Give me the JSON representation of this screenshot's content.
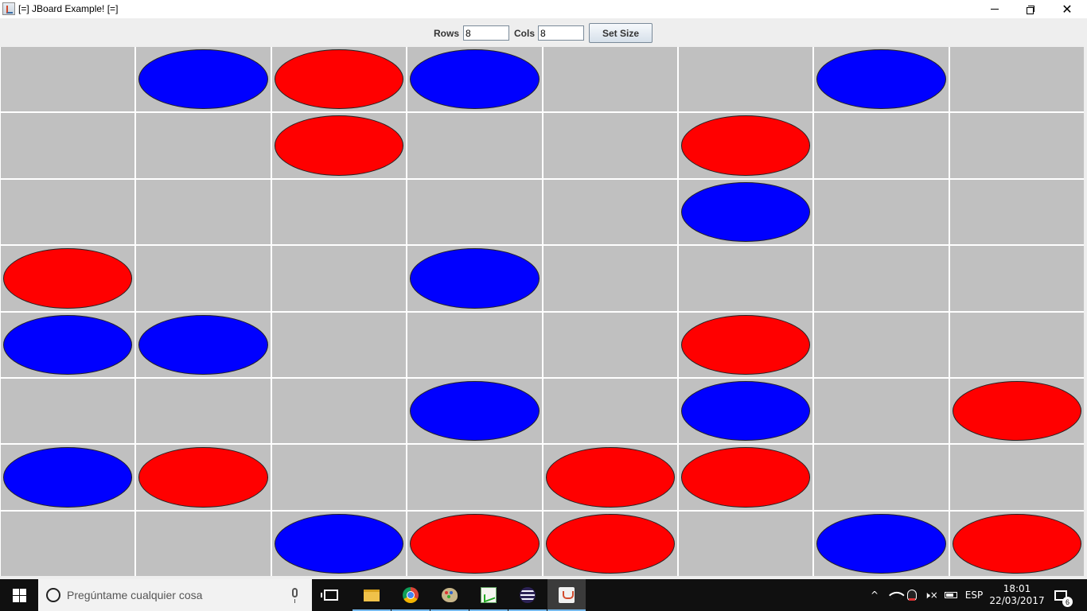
{
  "window": {
    "title": "[=] JBoard Example! [=]",
    "controls": {
      "minimize": "minimize",
      "maximize": "restore",
      "close": "close"
    }
  },
  "toolbar": {
    "rows_label": "Rows",
    "rows_value": "8",
    "cols_label": "Cols",
    "cols_value": "8",
    "set_size_label": "Set Size"
  },
  "board": {
    "rows": 8,
    "cols": 8,
    "empty_color": "#c0c0c0",
    "grid_color": "#ffffff",
    "piece_colors": {
      "R": "#ff0000",
      "B": "#0000ff"
    },
    "cells": [
      [
        ".",
        "B",
        "R",
        "B",
        ".",
        ".",
        "B",
        "."
      ],
      [
        ".",
        ".",
        "R",
        ".",
        ".",
        "R",
        ".",
        "."
      ],
      [
        ".",
        ".",
        ".",
        ".",
        ".",
        "B",
        ".",
        "."
      ],
      [
        "R",
        ".",
        ".",
        "B",
        ".",
        ".",
        ".",
        "."
      ],
      [
        "B",
        "B",
        ".",
        ".",
        ".",
        "R",
        ".",
        "."
      ],
      [
        ".",
        ".",
        ".",
        "B",
        ".",
        "B",
        ".",
        "R"
      ],
      [
        "B",
        "R",
        ".",
        ".",
        "R",
        "R",
        ".",
        "."
      ],
      [
        ".",
        ".",
        "B",
        "R",
        "R",
        ".",
        "B",
        "R"
      ]
    ]
  },
  "taskbar": {
    "search_placeholder": "Pregúntame cualquier cosa",
    "apps": [
      "task-view",
      "file-explorer",
      "chrome",
      "paint",
      "chart-app",
      "eclipse",
      "java"
    ],
    "tray": {
      "language": "ESP",
      "time": "18:01",
      "date": "22/03/2017",
      "notification_count": "6"
    }
  }
}
